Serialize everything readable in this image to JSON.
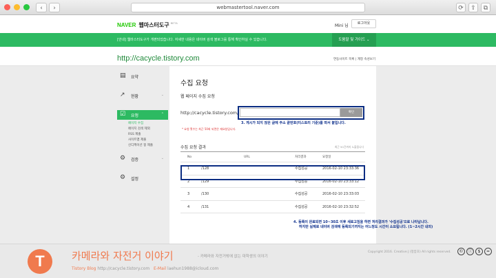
{
  "browser": {
    "url": "webmastertool.naver.com",
    "reload_icon": "⟳",
    "share_icon": "⇪",
    "tabs_icon": "⧉",
    "back_icon": "‹",
    "forward_icon": "›"
  },
  "header": {
    "brand": "NAVER",
    "service": "웹마스터도구",
    "beta": "BETA",
    "user": "Mini 님",
    "login_button": "로그아웃"
  },
  "notice": {
    "text": "[안내] 웹마스터도구가 개편되었습니다. 자세한 내용은 네이버 검색 블로그를 통해 확인하실 수 있습니다.",
    "help": "도움말 및 가이드 ⌄"
  },
  "site": {
    "url": "http://cacycle.tistory.com",
    "caret": "⌄",
    "links": "연동사이트 목록 | 계정 속성보기"
  },
  "sidebar": {
    "items": [
      {
        "icon": "▤",
        "label": "요약",
        "chev": ""
      },
      {
        "icon": "↗",
        "label": "현황",
        "chev": "⌄"
      },
      {
        "icon": "☑",
        "label": "요청",
        "chev": "⌃"
      },
      {
        "icon": "⚙",
        "label": "검증",
        "chev": "⌄"
      },
      {
        "icon": "⚙",
        "label": "설정",
        "chev": ""
      }
    ],
    "submenu": [
      "페이지 수집",
      "페이지 검색 제외",
      "RSS 제출",
      "사이트맵 제출",
      "신디케이션 핑 제출"
    ]
  },
  "main": {
    "title": "수집 요청",
    "subhead": "웹 페이지 수집 요청",
    "url_prefix": "http://cacycle.tistory.com/",
    "input_value": "",
    "request_button": "확인",
    "note": "* 요청 횟수는 최근 50회 되면은 재요청입니다.",
    "results_title": "수집 요청 결과",
    "results_info": "최근 50건까지 노출됩니다",
    "table": {
      "columns": [
        "No",
        "URL",
        "처리결과",
        "요청일"
      ],
      "rows": [
        {
          "no": "1",
          "url": "/128",
          "status": "수집성공",
          "date": "2016-02-10 23:33:36"
        },
        {
          "no": "2",
          "url": "/129",
          "status": "수집성공",
          "date": "2016-02-10 23:33:12"
        },
        {
          "no": "3",
          "url": "/130",
          "status": "수집성공",
          "date": "2016-02-10 23:33:03"
        },
        {
          "no": "4",
          "url": "/131",
          "status": "수집성공",
          "date": "2016-02-10 23:32:52"
        }
      ]
    }
  },
  "annotations": {
    "a3": "3. 게시가 되지 않은 글에 주소 끝번호(티스토리 기준)를 따서 붙입니다.",
    "a4_line1": "4. 등록이 완료되면 10~30초 이후 새로고침을 하면 처리결과가 '수집성공'으로 나타납니다.",
    "a4_line2": "하지만 실제로 네이버 검색에 등록되기까지는 어느정도 시간이 소요됩니다. (1~2시간 내외)"
  },
  "banner": {
    "logo_letter": "T",
    "blog_name": "카메라와 자전거 이야기",
    "tagline": "- 카메라와 자전거밖에 없는 대학생의 이야기",
    "meta_prefix": "Tistory Blog",
    "blog_url": "http://cacycle.tistory.com",
    "email_prefix": "E-Mail",
    "email": "laehun1988@icloud.com",
    "copyright": "Copyright 2016. Creative J (정암호) All rights reserved.",
    "cc": [
      "©",
      "ⓘ",
      "$",
      "="
    ]
  }
}
